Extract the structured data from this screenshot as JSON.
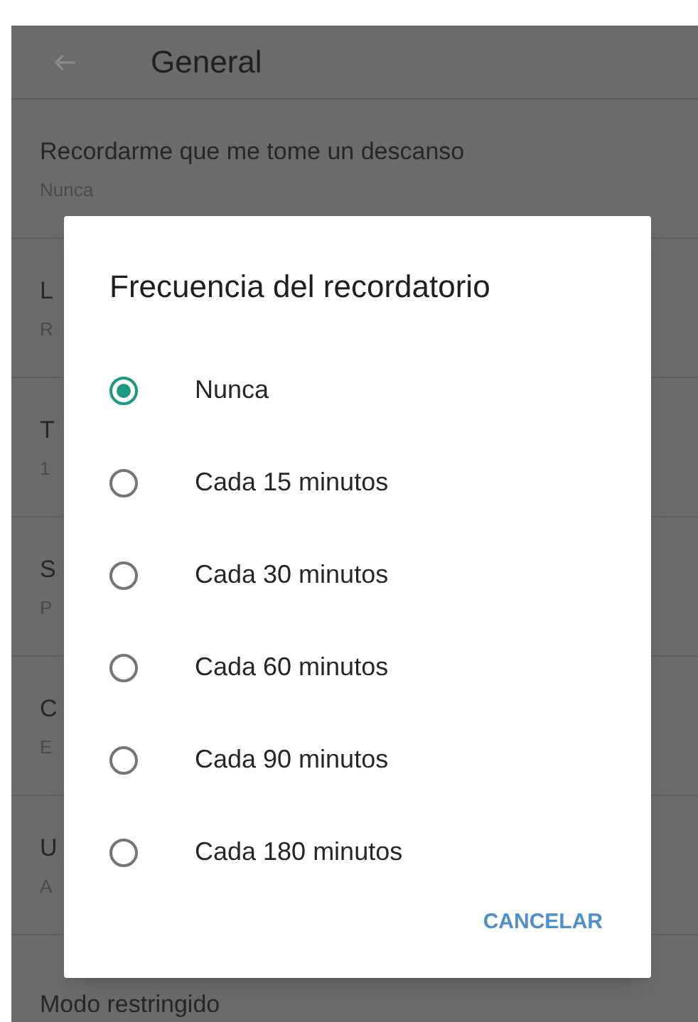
{
  "header": {
    "title": "General"
  },
  "settings": [
    {
      "title": "Recordarme que me tome un descanso",
      "subtitle": "Nunca"
    },
    {
      "title": "L",
      "subtitle": "R"
    },
    {
      "title": "T",
      "subtitle": "1"
    },
    {
      "title": "S",
      "subtitle": "P"
    },
    {
      "title": "C",
      "subtitle": "E"
    },
    {
      "title": "U",
      "subtitle": "A"
    },
    {
      "title": "Modo restringido"
    }
  ],
  "dialog": {
    "title": "Frecuencia del recordatorio",
    "options": [
      {
        "label": "Nunca",
        "selected": true
      },
      {
        "label": "Cada 15 minutos",
        "selected": false
      },
      {
        "label": "Cada 30 minutos",
        "selected": false
      },
      {
        "label": "Cada 60 minutos",
        "selected": false
      },
      {
        "label": "Cada 90 minutos",
        "selected": false
      },
      {
        "label": "Cada 180 minutos",
        "selected": false
      }
    ],
    "button": "CANCELAR"
  }
}
